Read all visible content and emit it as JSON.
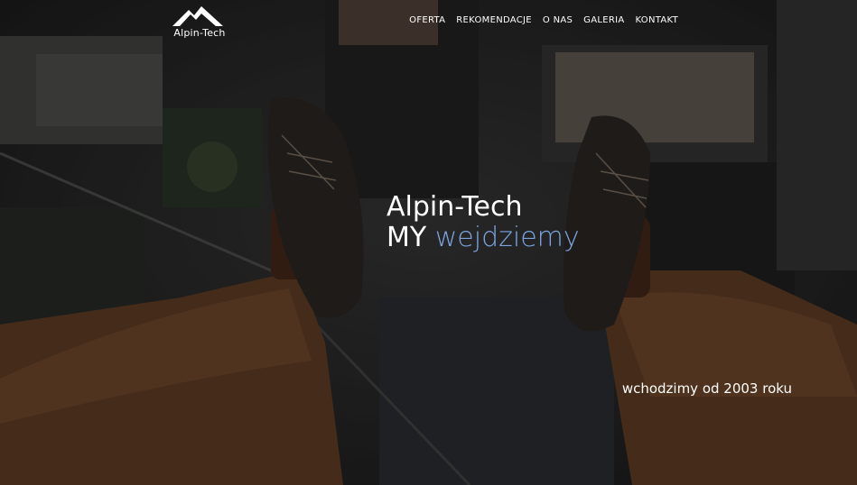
{
  "header": {
    "logo_text": "Alpin-Tech",
    "nav": [
      "OFERTA",
      "REKOMENDACJE",
      "O NAS",
      "GALERIA",
      "KONTAKT"
    ]
  },
  "hero": {
    "title_line1": "Alpin-Tech",
    "title_line2_prefix": "MY",
    "title_line2_accent": "wejdziemy",
    "tagline": "wchodzimy od 2003 roku",
    "accent_color": "#7aa3df"
  }
}
